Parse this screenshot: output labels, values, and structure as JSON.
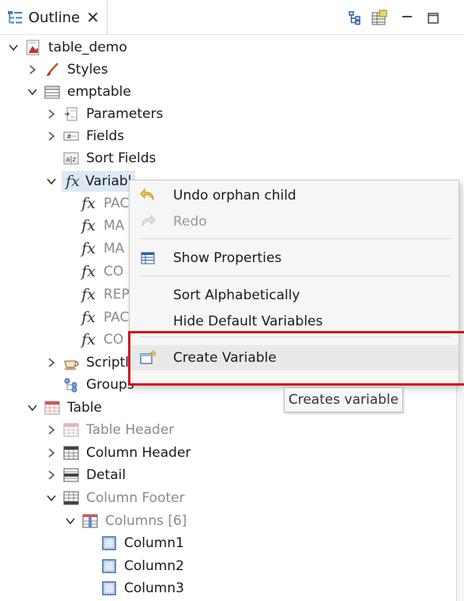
{
  "tab": {
    "title": "Outline",
    "close_glyph": "✕"
  },
  "toolbar": {
    "buttons": [
      {
        "name": "tree-layout-icon"
      },
      {
        "name": "table-filter-icon"
      },
      {
        "name": "minimize-icon"
      },
      {
        "name": "maximize-icon"
      }
    ]
  },
  "tree": {
    "root": "table_demo",
    "styles": "Styles",
    "emptable": "emptable",
    "parameters": "Parameters",
    "fields": "Fields",
    "sort_fields": "Sort Fields",
    "variables": "Variabl",
    "variable_items": [
      "PAC",
      "MA",
      "MA",
      "CO",
      "REP",
      "PAC",
      "CO"
    ],
    "scriptlets": "Scriptl",
    "groups": "Groups",
    "table": "Table",
    "table_header": "Table Header",
    "column_header": "Column Header",
    "detail": "Detail",
    "column_footer": "Column Footer",
    "columns": "Columns [6]",
    "column_items": [
      "Column1",
      "Column2",
      "Column3"
    ]
  },
  "context_menu": {
    "undo": "Undo orphan child",
    "redo": "Redo",
    "show_properties": "Show Properties",
    "sort_alpha": "Sort Alphabetically",
    "hide_default": "Hide Default Variables",
    "create_variable": "Create Variable"
  },
  "tooltip": "Creates variable",
  "colors": {
    "selection": "#dde8f7",
    "highlight_border": "#d0141c",
    "menu_bg": "#f6f6f6"
  }
}
